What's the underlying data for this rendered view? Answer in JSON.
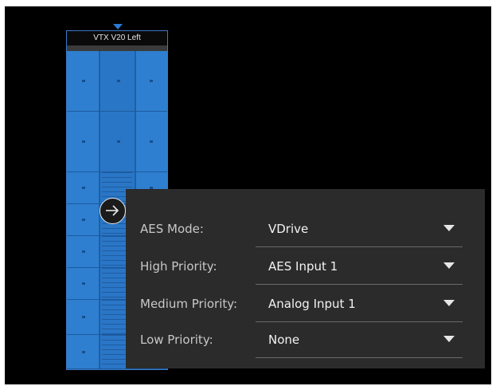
{
  "speaker": {
    "title": "VTX V20 Left",
    "color": "#2a78c8"
  },
  "arrow_button": {
    "icon": "arrow-right-circle-icon"
  },
  "panel": {
    "rows": [
      {
        "label": "AES Mode:",
        "value": "VDrive"
      },
      {
        "label": "High Priority:",
        "value": "AES Input 1"
      },
      {
        "label": "Medium Priority:",
        "value": "Analog Input 1"
      },
      {
        "label": "Low Priority:",
        "value": "None"
      }
    ],
    "dropdown_icon": "caret-down-icon"
  },
  "colors": {
    "background": "#000000",
    "panel": "#2b2b2b",
    "accent": "#2a78c8"
  }
}
